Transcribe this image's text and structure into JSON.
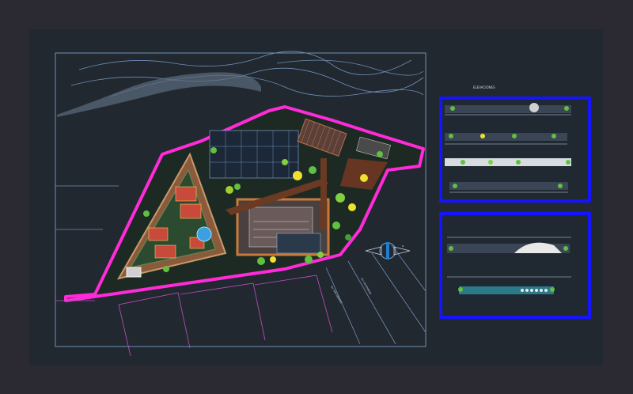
{
  "drawing": {
    "background": "#212830",
    "frame_color": "#2b2931",
    "line_color": "#6f8fb6",
    "boundary_color": "#ff2bd8",
    "panel_border_color": "#1414ff",
    "street_label_1": "AV. SAN ANDRES",
    "street_label_2": "AV. COSTANERA",
    "sheet_title": "ELEVACIONES",
    "north_arrow_label": "N"
  }
}
